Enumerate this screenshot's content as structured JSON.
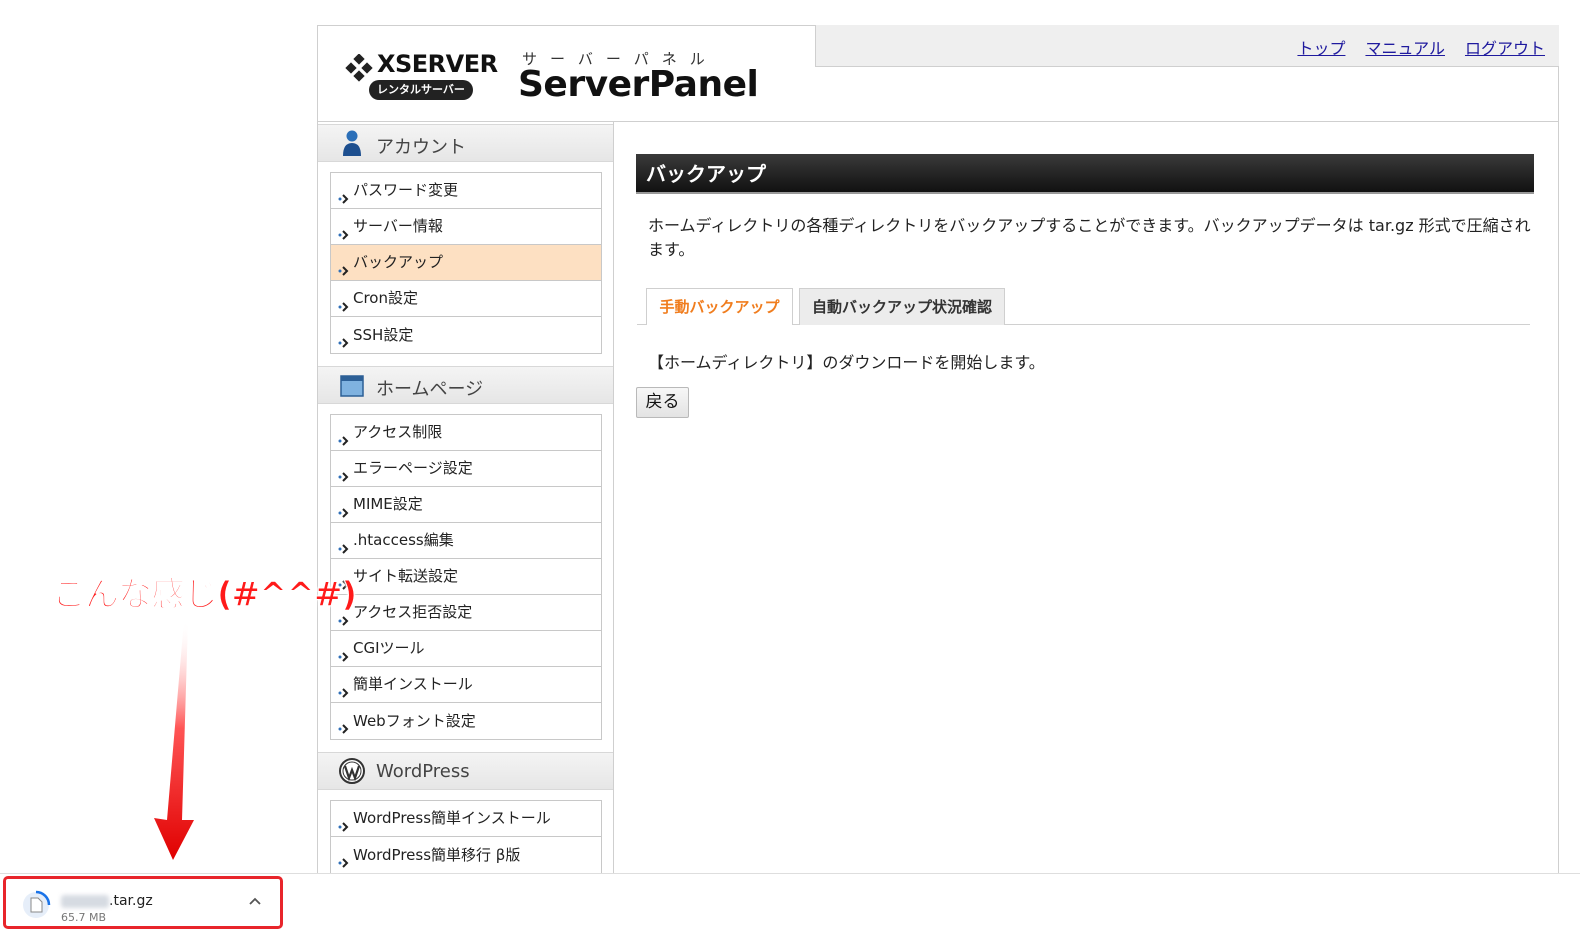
{
  "header": {
    "brand": "XSERVER",
    "brand_sub": "レンタルサーバー",
    "panel_kana": "サーバーパネル",
    "panel_title": "ServerPanel",
    "links": [
      "トップ",
      "マニュアル",
      "ログアウト"
    ]
  },
  "sidebar": {
    "sections": [
      {
        "label": "アカウント",
        "icon": "user-icon",
        "items": [
          "パスワード変更",
          "サーバー情報",
          "バックアップ",
          "Cron設定",
          "SSH設定"
        ],
        "active_index": 2
      },
      {
        "label": "ホームページ",
        "icon": "window-icon",
        "items": [
          "アクセス制限",
          "エラーページ設定",
          "MIME設定",
          ".htaccess編集",
          "サイト転送設定",
          "アクセス拒否設定",
          "CGIツール",
          "簡単インストール",
          "Webフォント設定"
        ]
      },
      {
        "label": "WordPress",
        "icon": "wordpress-icon",
        "items": [
          "WordPress簡単インストール",
          "WordPress簡単移行 β版"
        ]
      }
    ]
  },
  "main": {
    "title": "バックアップ",
    "description": "ホームディレクトリの各種ディレクトリをバックアップすることができます。バックアップデータは tar.gz 形式で圧縮されます。",
    "tabs": [
      {
        "label": "手動バックアップ",
        "active": true
      },
      {
        "label": "自動バックアップ状況確認",
        "active": false
      }
    ],
    "notice": "【ホームディレクトリ】のダウンロードを開始します。",
    "back_button": "戻る"
  },
  "download": {
    "filename_suffix": ".tar.gz",
    "size": "65.7 MB"
  },
  "annotation": {
    "text": "こんな感じ(#^^#)"
  },
  "colors": {
    "accent_tab": "#f07d1e",
    "active_menu_bg": "#fde0c2",
    "highlight_red": "#e8252b",
    "link": "#1f1a9e"
  }
}
